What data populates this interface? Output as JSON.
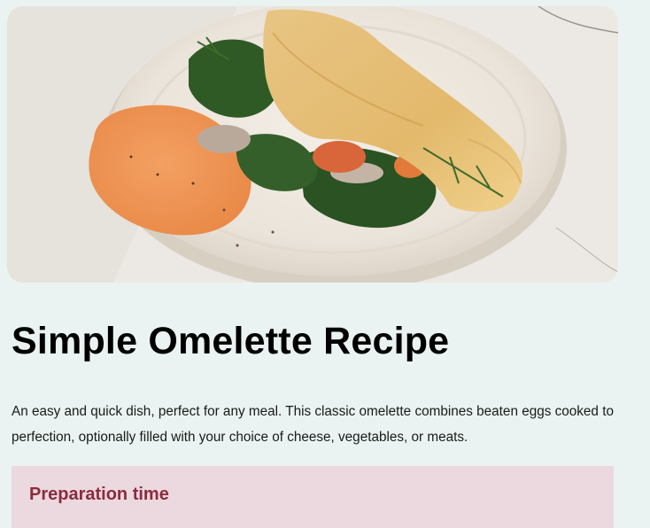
{
  "hero_image": {
    "subject": "folded-omelette-plate-photo"
  },
  "recipe": {
    "title": "Simple Omelette Recipe",
    "description": "An easy and quick dish, perfect for any meal. This classic omelette combines beaten eggs cooked to perfection, optionally filled with your choice of cheese, vegetables, or meats."
  },
  "preparation": {
    "heading": "Preparation time"
  },
  "colors": {
    "page_background": "#eaf3f1",
    "title_text": "#000000",
    "prep_panel_background": "#ecd8df",
    "prep_heading_text": "#8a2c3c"
  }
}
